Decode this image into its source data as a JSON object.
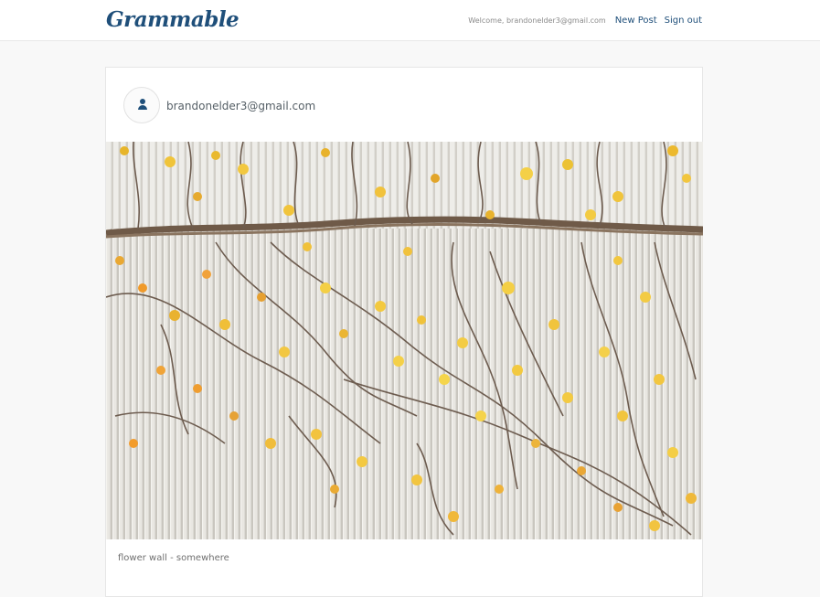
{
  "navbar": {
    "brand": "Grammable",
    "welcome": "Welcome, brandonelder3@gmail.com",
    "new_post": "New Post",
    "sign_out": "Sign out"
  },
  "post": {
    "username": "brandonelder3@gmail.com",
    "avatar_icon": "user-icon",
    "caption": "flower wall - somewhere",
    "photo_description": "ivy-wall-photo"
  },
  "colors": {
    "brand": "#1f4f7a",
    "page_background": "#f8f8f8",
    "card_background": "#ffffff"
  }
}
